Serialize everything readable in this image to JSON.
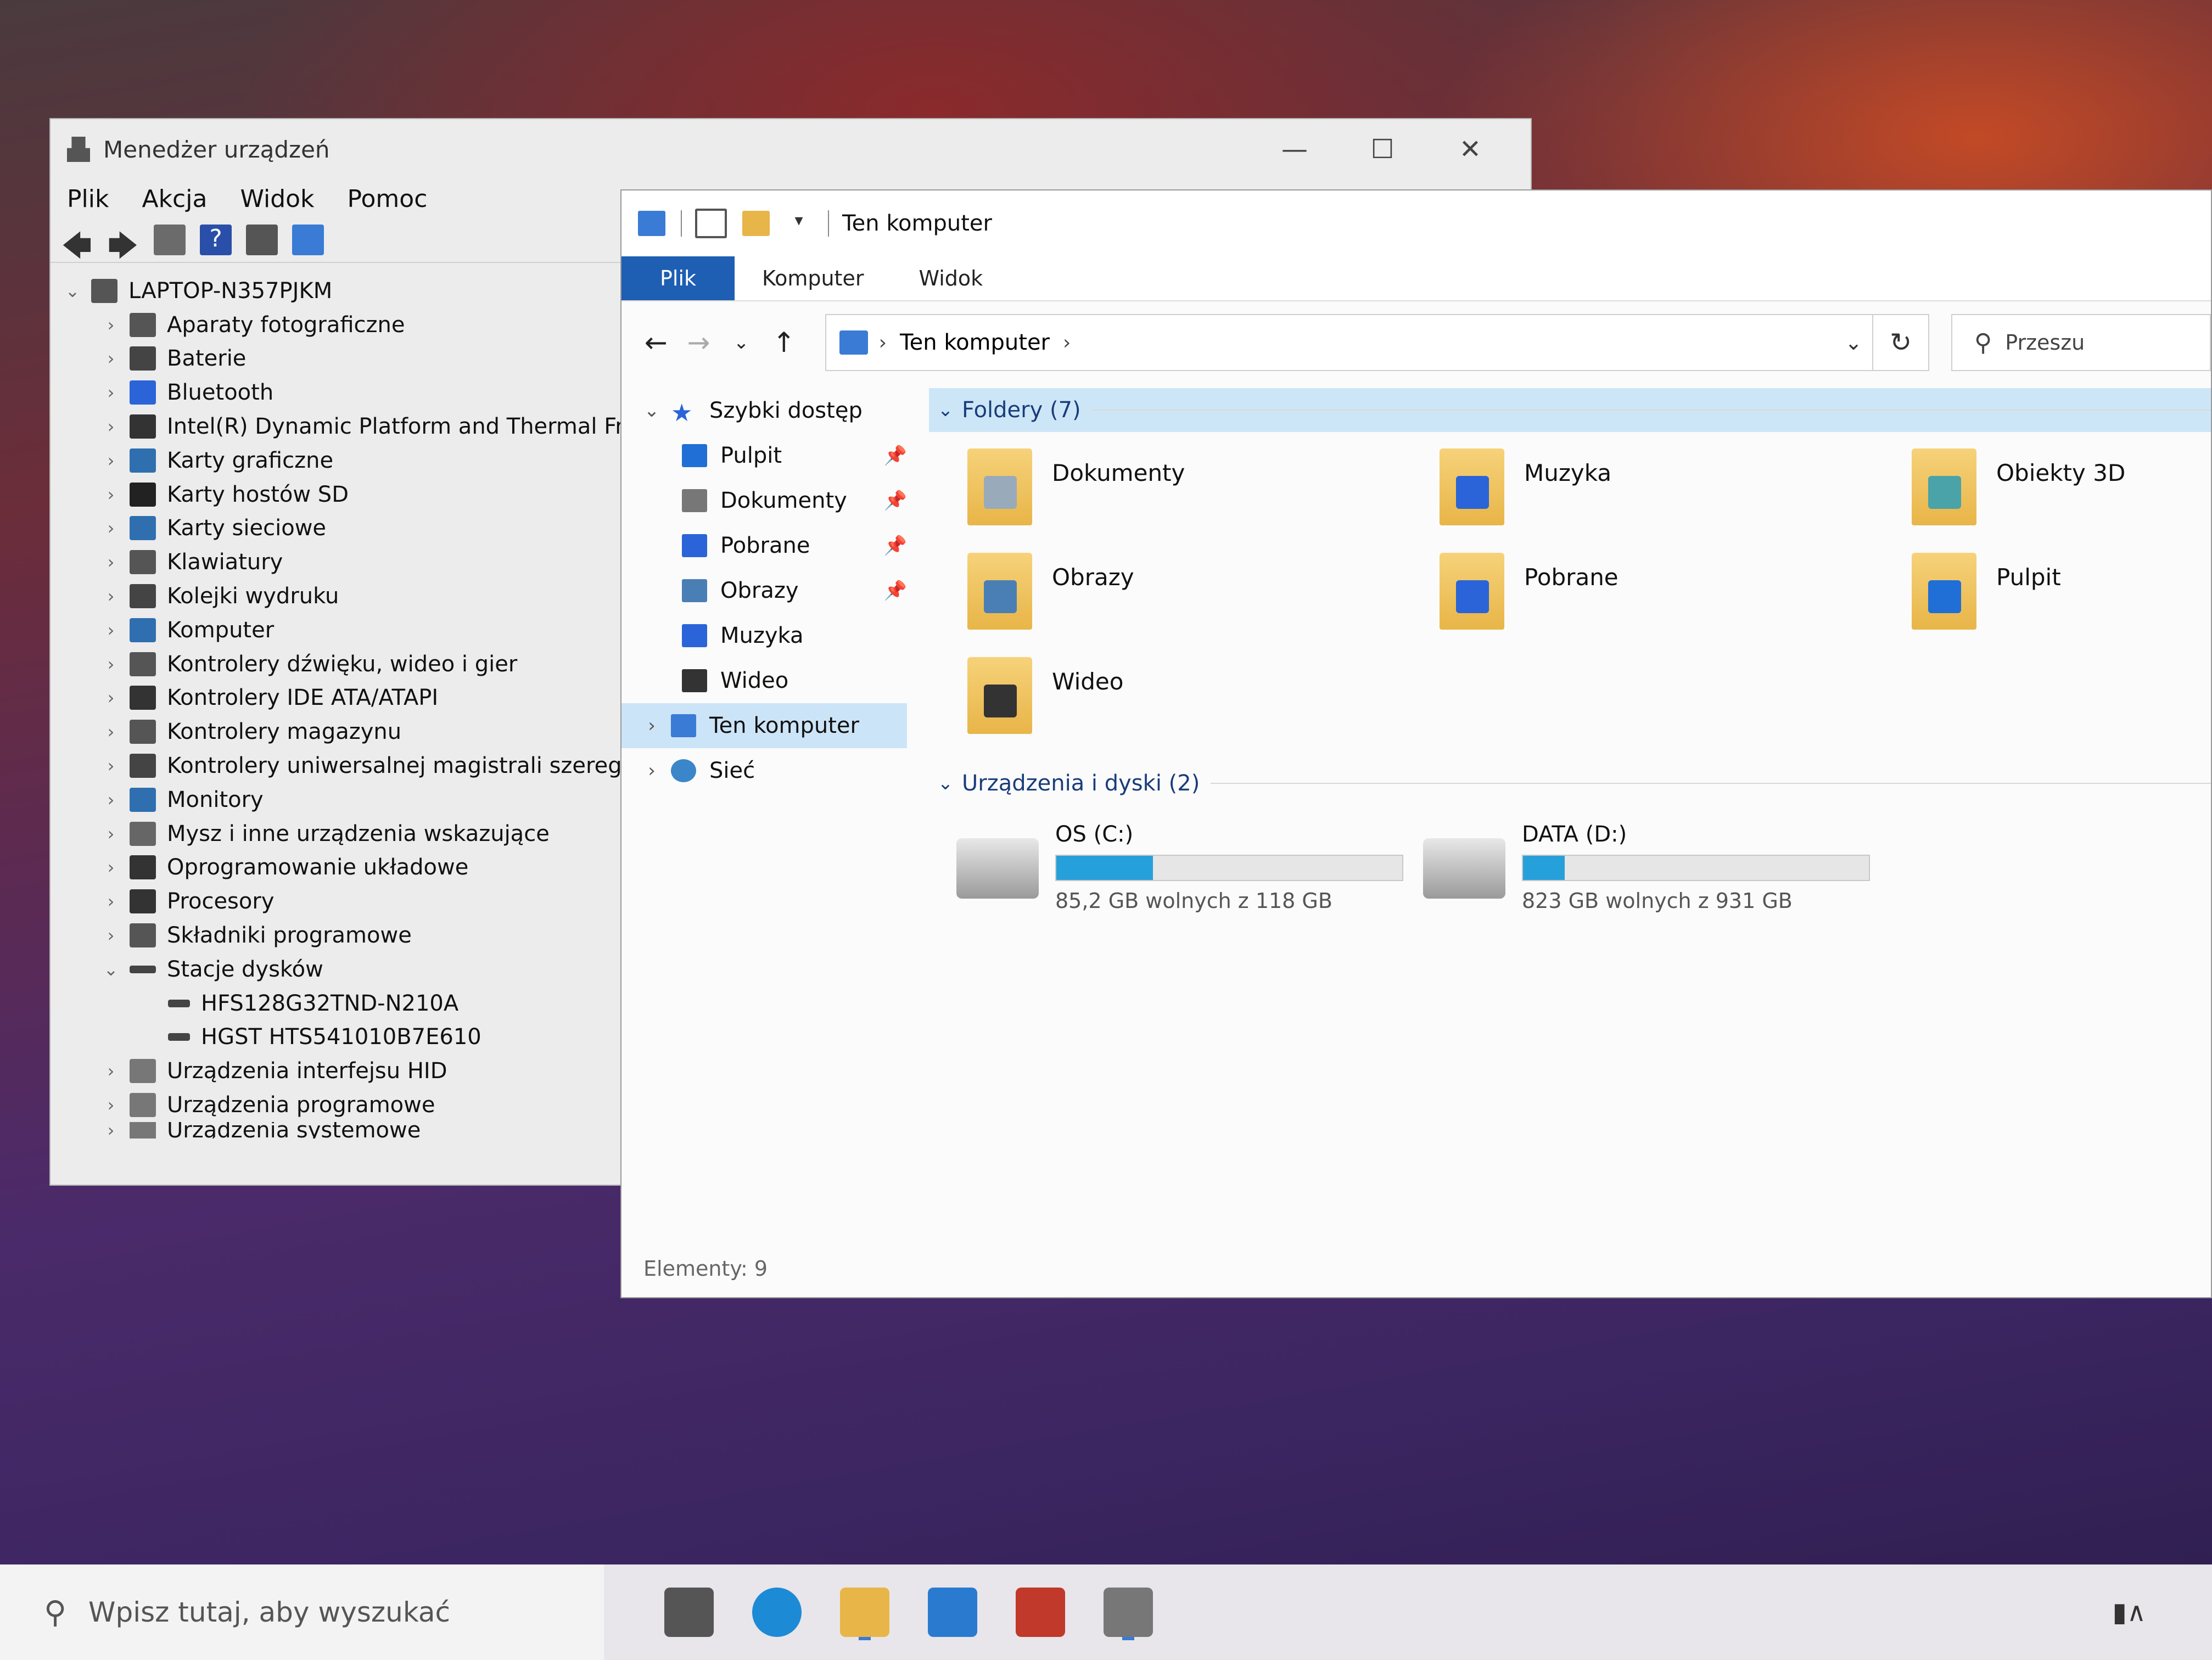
{
  "colors": {
    "accent": "#1e5eb3",
    "selection": "#cce4f7",
    "drive_bar": "#26a0da"
  },
  "device_manager": {
    "title": "Menedżer urządzeń",
    "menu": [
      "Plik",
      "Akcja",
      "Widok",
      "Pomoc"
    ],
    "root": "LAPTOP-N357PJKM",
    "categories": [
      {
        "label": "Aparaty fotograficzne",
        "icon": "camera-icon",
        "color": "#555"
      },
      {
        "label": "Baterie",
        "icon": "battery-icon",
        "color": "#444"
      },
      {
        "label": "Bluetooth",
        "icon": "bluetooth-icon",
        "color": "#2a64d8"
      },
      {
        "label": "Intel(R) Dynamic Platform and Thermal Framew",
        "icon": "chip-icon",
        "color": "#333"
      },
      {
        "label": "Karty graficzne",
        "icon": "display-adapter-icon",
        "color": "#2f6fb0"
      },
      {
        "label": "Karty hostów SD",
        "icon": "sd-card-icon",
        "color": "#222"
      },
      {
        "label": "Karty sieciowe",
        "icon": "network-icon",
        "color": "#2f6fb0"
      },
      {
        "label": "Klawiatury",
        "icon": "keyboard-icon",
        "color": "#555"
      },
      {
        "label": "Kolejki wydruku",
        "icon": "printer-icon",
        "color": "#444"
      },
      {
        "label": "Komputer",
        "icon": "computer-icon",
        "color": "#2f6fb0"
      },
      {
        "label": "Kontrolery dźwięku, wideo i gier",
        "icon": "speaker-icon",
        "color": "#555"
      },
      {
        "label": "Kontrolery IDE ATA/ATAPI",
        "icon": "ide-icon",
        "color": "#333"
      },
      {
        "label": "Kontrolery magazynu",
        "icon": "storage-controller-icon",
        "color": "#555"
      },
      {
        "label": "Kontrolery uniwersalnej magistrali szeregowej",
        "icon": "usb-icon",
        "color": "#444"
      },
      {
        "label": "Monitory",
        "icon": "monitor-icon",
        "color": "#2f6fb0"
      },
      {
        "label": "Mysz i inne urządzenia wskazujące",
        "icon": "mouse-icon",
        "color": "#666"
      },
      {
        "label": "Oprogramowanie układowe",
        "icon": "firmware-icon",
        "color": "#333"
      },
      {
        "label": "Procesory",
        "icon": "cpu-icon",
        "color": "#333"
      },
      {
        "label": "Składniki programowe",
        "icon": "software-component-icon",
        "color": "#555"
      }
    ],
    "expanded_category": "Stacje dysków",
    "disk_drives": [
      "HFS128G32TND-N210A",
      "HGST HTS541010B7E610"
    ],
    "after": [
      "Urządzenia interfejsu HID",
      "Urządzenia programowe",
      "Urządzenia systemowe"
    ]
  },
  "explorer": {
    "title": "Ten komputer",
    "ribbon_tabs": [
      "Plik",
      "Komputer",
      "Widok"
    ],
    "address": "Ten komputer",
    "search_placeholder": "Przeszu",
    "nav": {
      "quick_access": "Szybki dostęp",
      "items": [
        {
          "label": "Pulpit",
          "icon": "desktop-icon",
          "color": "#1f6fd6",
          "pinned": true
        },
        {
          "label": "Dokumenty",
          "icon": "documents-icon",
          "color": "#777",
          "pinned": true
        },
        {
          "label": "Pobrane",
          "icon": "download-icon",
          "color": "#2a64d8",
          "pinned": true
        },
        {
          "label": "Obrazy",
          "icon": "pictures-icon",
          "color": "#4a7fb5",
          "pinned": true
        },
        {
          "label": "Muzyka",
          "icon": "music-icon",
          "color": "#2a64d8",
          "pinned": false
        },
        {
          "label": "Wideo",
          "icon": "video-icon",
          "color": "#333",
          "pinned": false
        }
      ],
      "this_pc": "Ten komputer",
      "network": "Sieć"
    },
    "folders_header": "Foldery (7)",
    "folders": [
      {
        "label": "Dokumenty",
        "mark": "#9ab"
      },
      {
        "label": "Muzyka",
        "mark": "#2a64d8"
      },
      {
        "label": "Obiekty 3D",
        "mark": "#4aa3a8"
      },
      {
        "label": "Obrazy",
        "mark": "#4a7fb5"
      },
      {
        "label": "Pobrane",
        "mark": "#2a64d8"
      },
      {
        "label": "Pulpit",
        "mark": "#1f6fd6"
      },
      {
        "label": "Wideo",
        "mark": "#333"
      }
    ],
    "drives_header": "Urządzenia i dyski (2)",
    "drives": [
      {
        "label": "OS (C:)",
        "free_text": "85,2 GB wolnych z 118 GB",
        "used_fraction": 0.28
      },
      {
        "label": "DATA (D:)",
        "free_text": "823 GB wolnych z 931 GB",
        "used_fraction": 0.12
      }
    ],
    "status": "Elementy: 9"
  },
  "taskbar": {
    "search_placeholder": "Wpisz tutaj, aby wyszukać",
    "apps": [
      {
        "icon": "task-view-icon",
        "color": "#555"
      },
      {
        "icon": "edge-icon",
        "color": "#1d8ad6"
      },
      {
        "icon": "file-explorer-icon",
        "color": "#e8b548"
      },
      {
        "icon": "mail-icon",
        "color": "#2a7bd0"
      },
      {
        "icon": "gift-icon",
        "color": "#c0392b"
      },
      {
        "icon": "device-manager-icon",
        "color": "#777"
      }
    ]
  }
}
